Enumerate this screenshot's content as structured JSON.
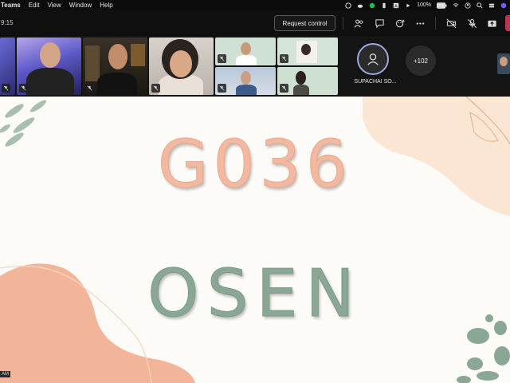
{
  "menubar": {
    "app": "Teams",
    "items": [
      "Edit",
      "View",
      "Window",
      "Help"
    ],
    "battery": "100%"
  },
  "meeting": {
    "timer": "9:15",
    "request_control_label": "Request control"
  },
  "participants": {
    "avatar_name": "SUPACHAI SO...",
    "overflow_count": "+102"
  },
  "slide": {
    "line1": "G036",
    "line2": "OSEN"
  },
  "corner_label": "AM",
  "colors": {
    "peach": "#f3b9a0",
    "sage": "#8aa796",
    "leave_red": "#c4314b",
    "avatar_ring": "#9fa6e0"
  }
}
